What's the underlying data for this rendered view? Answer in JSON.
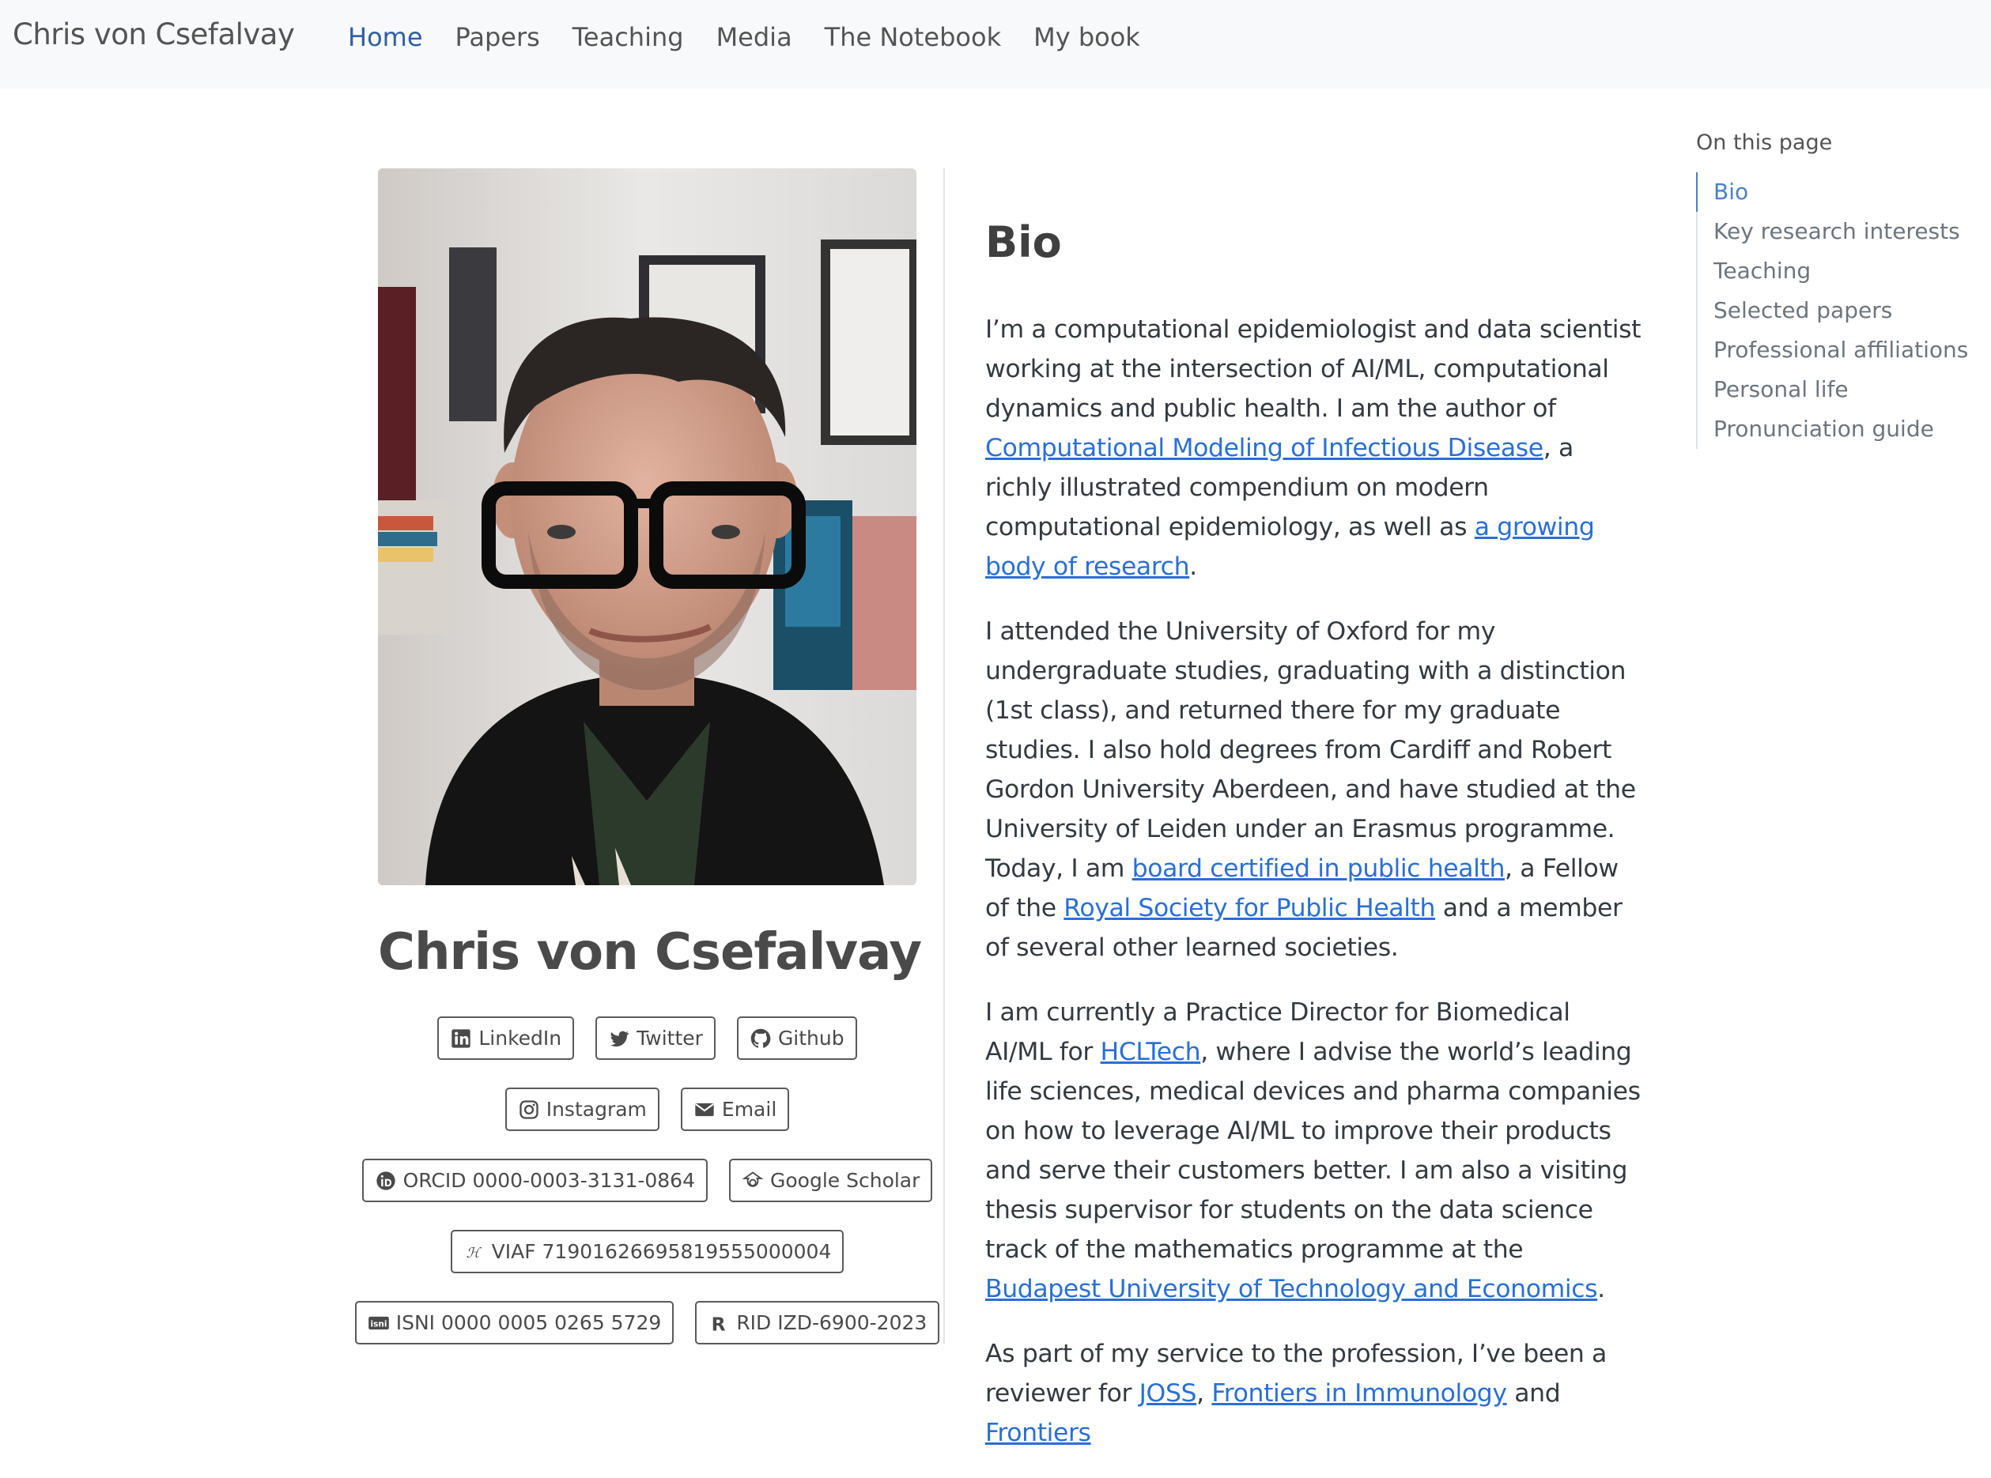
{
  "nav": {
    "brand": "Chris von Csefalvay",
    "links": [
      {
        "label": "Home",
        "active": true
      },
      {
        "label": "Papers"
      },
      {
        "label": "Teaching"
      },
      {
        "label": "Media"
      },
      {
        "label": "The Notebook"
      },
      {
        "label": "My book"
      }
    ]
  },
  "profile": {
    "name": "Chris von Csefalvay",
    "buttons": {
      "linkedin": "LinkedIn",
      "twitter": "Twitter",
      "github": "Github",
      "instagram": "Instagram",
      "email": "Email",
      "orcid": "ORCID 0000-0003-3131-0864",
      "scholar": "Google Scholar",
      "viaf": "VIAF 71901626695819555000004",
      "isni": "ISNI 0000 0005 0265 5729",
      "rid": "RID IZD-6900-2023"
    }
  },
  "bio": {
    "heading": "Bio",
    "p1": {
      "t1": "I’m a computational epidemiologist and data scientist working at the intersection of AI/ML, computational dynamics and public health. I am the author of ",
      "l1": "Computational Modeling of Infectious Disease",
      "t2": ", a richly illustrated compendium on modern computational epidemiology, as well as ",
      "l2": "a growing body of research",
      "t3": "."
    },
    "p2": {
      "t1": "I attended the University of Oxford for my undergraduate studies, graduating with a distinction (1st class), and returned there for my graduate studies. I also hold degrees from Cardiff and Robert Gordon University Aberdeen, and have studied at the University of Leiden under an Erasmus programme. Today, I am ",
      "l1": "board certified in public health",
      "t2": ", a Fellow of the ",
      "l2": "Royal Society for Public Health",
      "t3": " and a member of several other learned societies."
    },
    "p3": {
      "t1": "I am currently a Practice Director for Biomedical AI/ML for ",
      "l1": "HCLTech",
      "t2": ", where I advise the world’s leading life sciences, medical devices and pharma companies on how to leverage AI/ML to improve their products and serve their customers better. I am also a visiting thesis supervisor for students on the data science track of the mathematics programme at the ",
      "l2": "Budapest University of Technology and Economics",
      "t3": "."
    },
    "p4": {
      "t1": "As part of my service to the profession, I’ve been a reviewer for ",
      "l1": "JOSS",
      "t2": ", ",
      "l2": "Frontiers in Immunology",
      "t3": " and ",
      "l3": "Frontiers"
    }
  },
  "toc": {
    "title": "On this page",
    "items": [
      "Bio",
      "Key research interests",
      "Teaching",
      "Selected papers",
      "Professional affiliations",
      "Personal life",
      "Pronunciation guide"
    ]
  }
}
